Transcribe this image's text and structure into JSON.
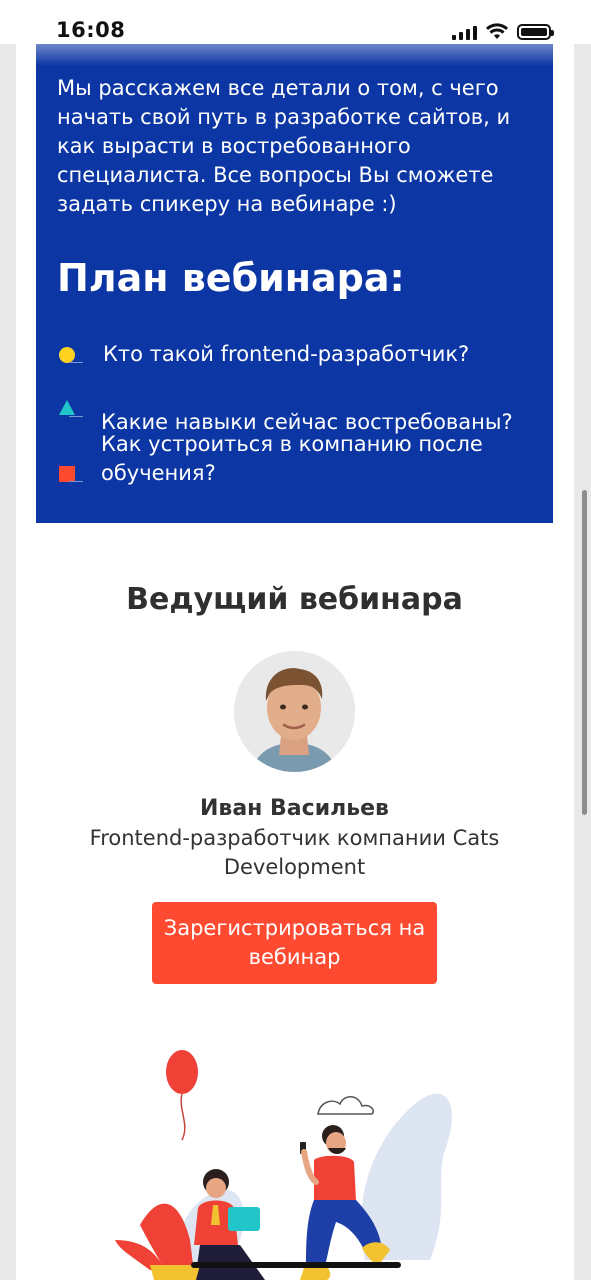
{
  "status_bar": {
    "time": "16:08"
  },
  "intro_text": "Мы расскажем все детали о том, с чего начать свой путь в разработке сайтов, и как вырасти в востребованного специалиста. Все вопросы Вы сможете задать спикеру на вебинаре :)",
  "plan": {
    "title": "План вебинара:",
    "items": [
      {
        "text": "Кто такой frontend-разработчик?",
        "icon": "yellow-circle",
        "color": "#ffd21f"
      },
      {
        "text": "Какие навыки сейчас востребованы?",
        "icon": "teal-triangle",
        "color": "#23c6c8"
      },
      {
        "text": "Как устроиться в компанию после обучения?",
        "icon": "red-square",
        "color": "#ff4a32"
      }
    ]
  },
  "presenter": {
    "section_title": "Ведущий вебинара",
    "name": "Иван Васильев",
    "role": "Frontend-разработчик компании Cats Development"
  },
  "cta": {
    "label": "Зарегистрироваться на вебинар"
  },
  "colors": {
    "blue_block": "#0c36a4",
    "accent": "#ff4a32"
  }
}
